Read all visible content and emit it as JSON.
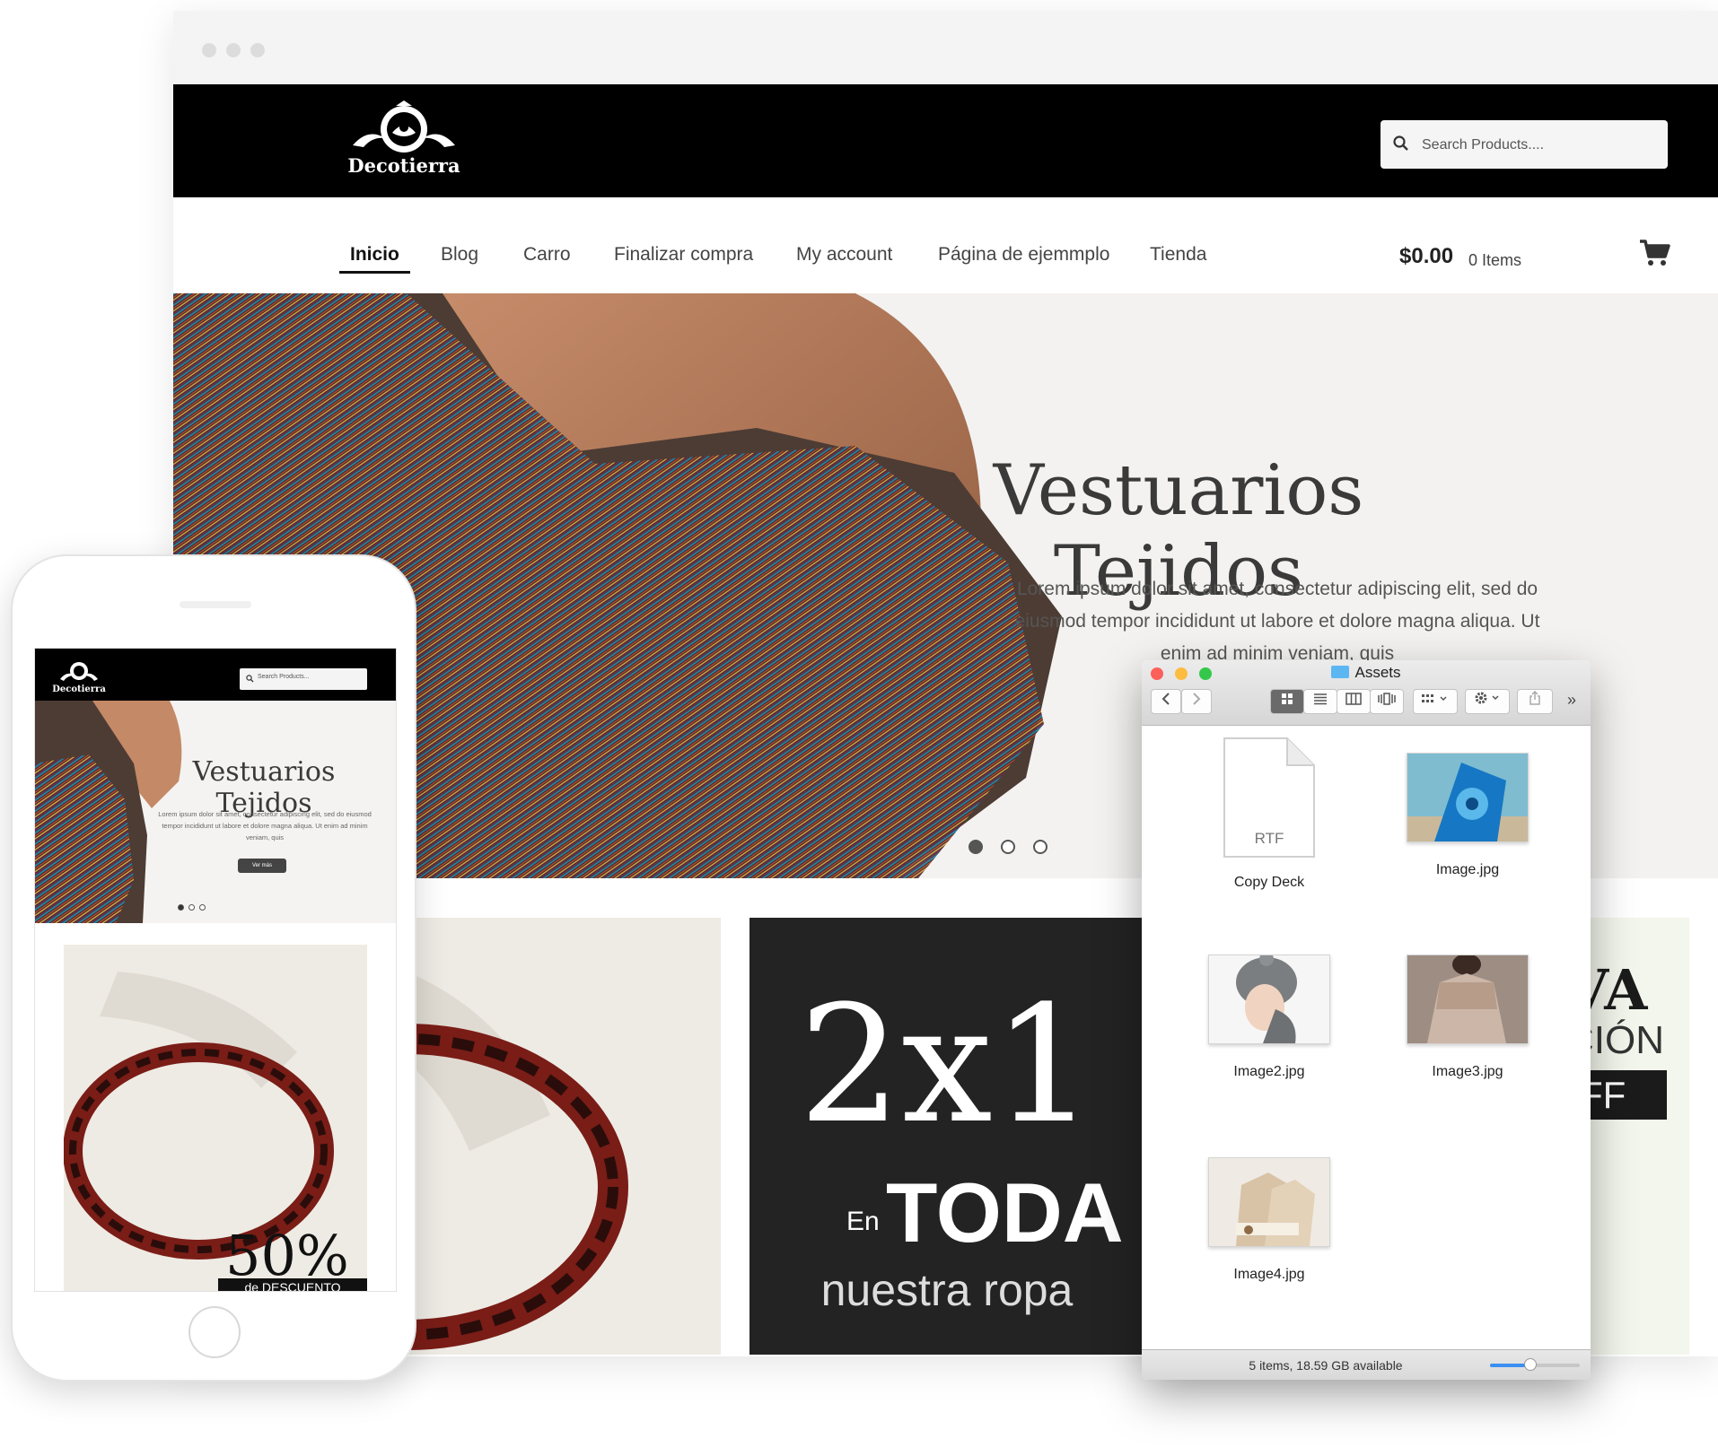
{
  "browser": {
    "store": {
      "logo_text": "Decotierra",
      "search": {
        "placeholder": "Search Products...."
      }
    },
    "nav": {
      "items": [
        {
          "label": "Inicio",
          "active": true
        },
        {
          "label": "Blog",
          "active": false
        },
        {
          "label": "Carro",
          "active": false
        },
        {
          "label": "Finalizar compra",
          "active": false
        },
        {
          "label": "My account",
          "active": false
        },
        {
          "label": "Página de ejemmplo",
          "active": false
        },
        {
          "label": "Tienda",
          "active": false
        }
      ],
      "cart_total": "$0.00",
      "cart_count": "0 Items",
      "cart_icon": "shopping-cart-icon"
    },
    "hero": {
      "title": "Vestuarios Tejidos",
      "text": "Lorem ipsum dolor sit amet, consectetur adipiscing elit, sed do eiusmod tempor incididunt ut labore et dolore magna aliqua. Ut enim ad minim veniam, quis",
      "slide_count": 3,
      "active_slide": 1
    },
    "promos": {
      "middle": {
        "big": "2x1",
        "en": "En",
        "toda": "TODA",
        "ropa": "nuestra ropa"
      },
      "right": {
        "line1": "VA",
        "line2": "CIÓN",
        "line3": "FF"
      }
    }
  },
  "finder": {
    "title": "Assets",
    "toolbar": {
      "back_icon": "chevron-left-icon",
      "forward_icon": "chevron-right-icon",
      "views": [
        "icon-view-icon",
        "list-view-icon",
        "column-view-icon",
        "cover-flow-icon"
      ],
      "group_icon": "group-icon",
      "action_icon": "gear-icon",
      "share_icon": "share-icon",
      "overflow": "»"
    },
    "items": [
      {
        "name": "Copy Deck",
        "kind": "RTF"
      },
      {
        "name": "Image.jpg"
      },
      {
        "name": "Image2.jpg"
      },
      {
        "name": "Image3.jpg"
      },
      {
        "name": "Image4.jpg"
      }
    ],
    "status": "5 items, 18.59 GB available",
    "zoom_level": 0.45,
    "colors": {
      "close": "#fc605b",
      "minimize": "#fdbc40",
      "zoom": "#34c84a",
      "accent": "#3b8ff0"
    }
  },
  "phone": {
    "logo_text": "Decotierra",
    "search_placeholder": "Search Products...",
    "hero_title": "Vestuarios Tejidos",
    "hero_text": "Lorem ipsum dolor sit amet, consectetur adipiscing elit, sed do eiusmod tempor incididunt ut labore et dolore magna aliqua. Ut enim ad minim veniam, quis",
    "hero_button": "Ver más",
    "slide_count": 3,
    "promo_discount": "50%",
    "promo_caption": "de DESCUENTO"
  }
}
